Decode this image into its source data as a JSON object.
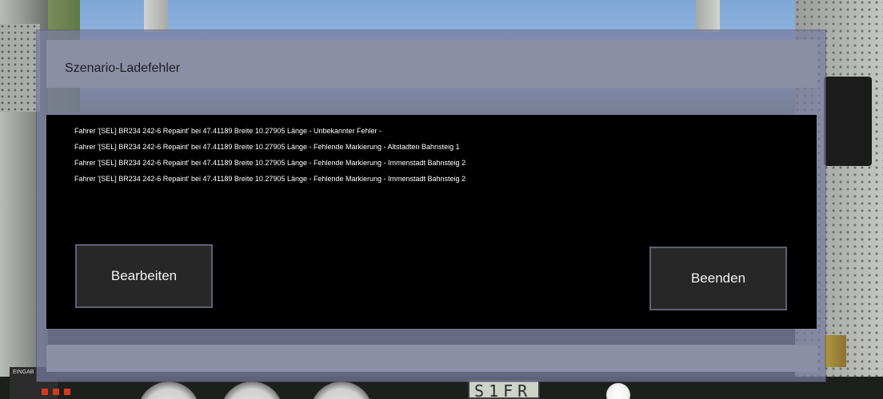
{
  "dialog": {
    "title": "Szenario-Ladefehler",
    "errors": [
      "Fahrer '[SEL] BR234 242-6 Repaint' bei 47.41189 Breite 10.27905 Länge - Unbekannter Fehler -",
      "Fahrer '[SEL] BR234 242-6 Repaint' bei 47.41189 Breite 10.27905 Länge - Fehlende Markierung - Altstadten Bahnsteig 1",
      "Fahrer '[SEL] BR234 242-6 Repaint' bei 47.41189 Breite 10.27905 Länge - Fehlende Markierung - Immenstadt Bahnsteig 2",
      "Fahrer '[SEL] BR234 242-6 Repaint' bei 47.41189 Breite 10.27905 Länge - Fehlende Markierung - Immenstadt Bahnsteig 2"
    ],
    "buttons": {
      "edit_label": "Bearbeiten",
      "quit_label": "Beenden"
    }
  },
  "background": {
    "display_text": "S1FR",
    "panel_label": "EINGAB"
  },
  "colors": {
    "dialog_title_bar": "#8c8ea6",
    "content_bg": "#000000",
    "button_bg": "#272727",
    "button_border": "#5d6174",
    "text_light": "#ffffff"
  }
}
